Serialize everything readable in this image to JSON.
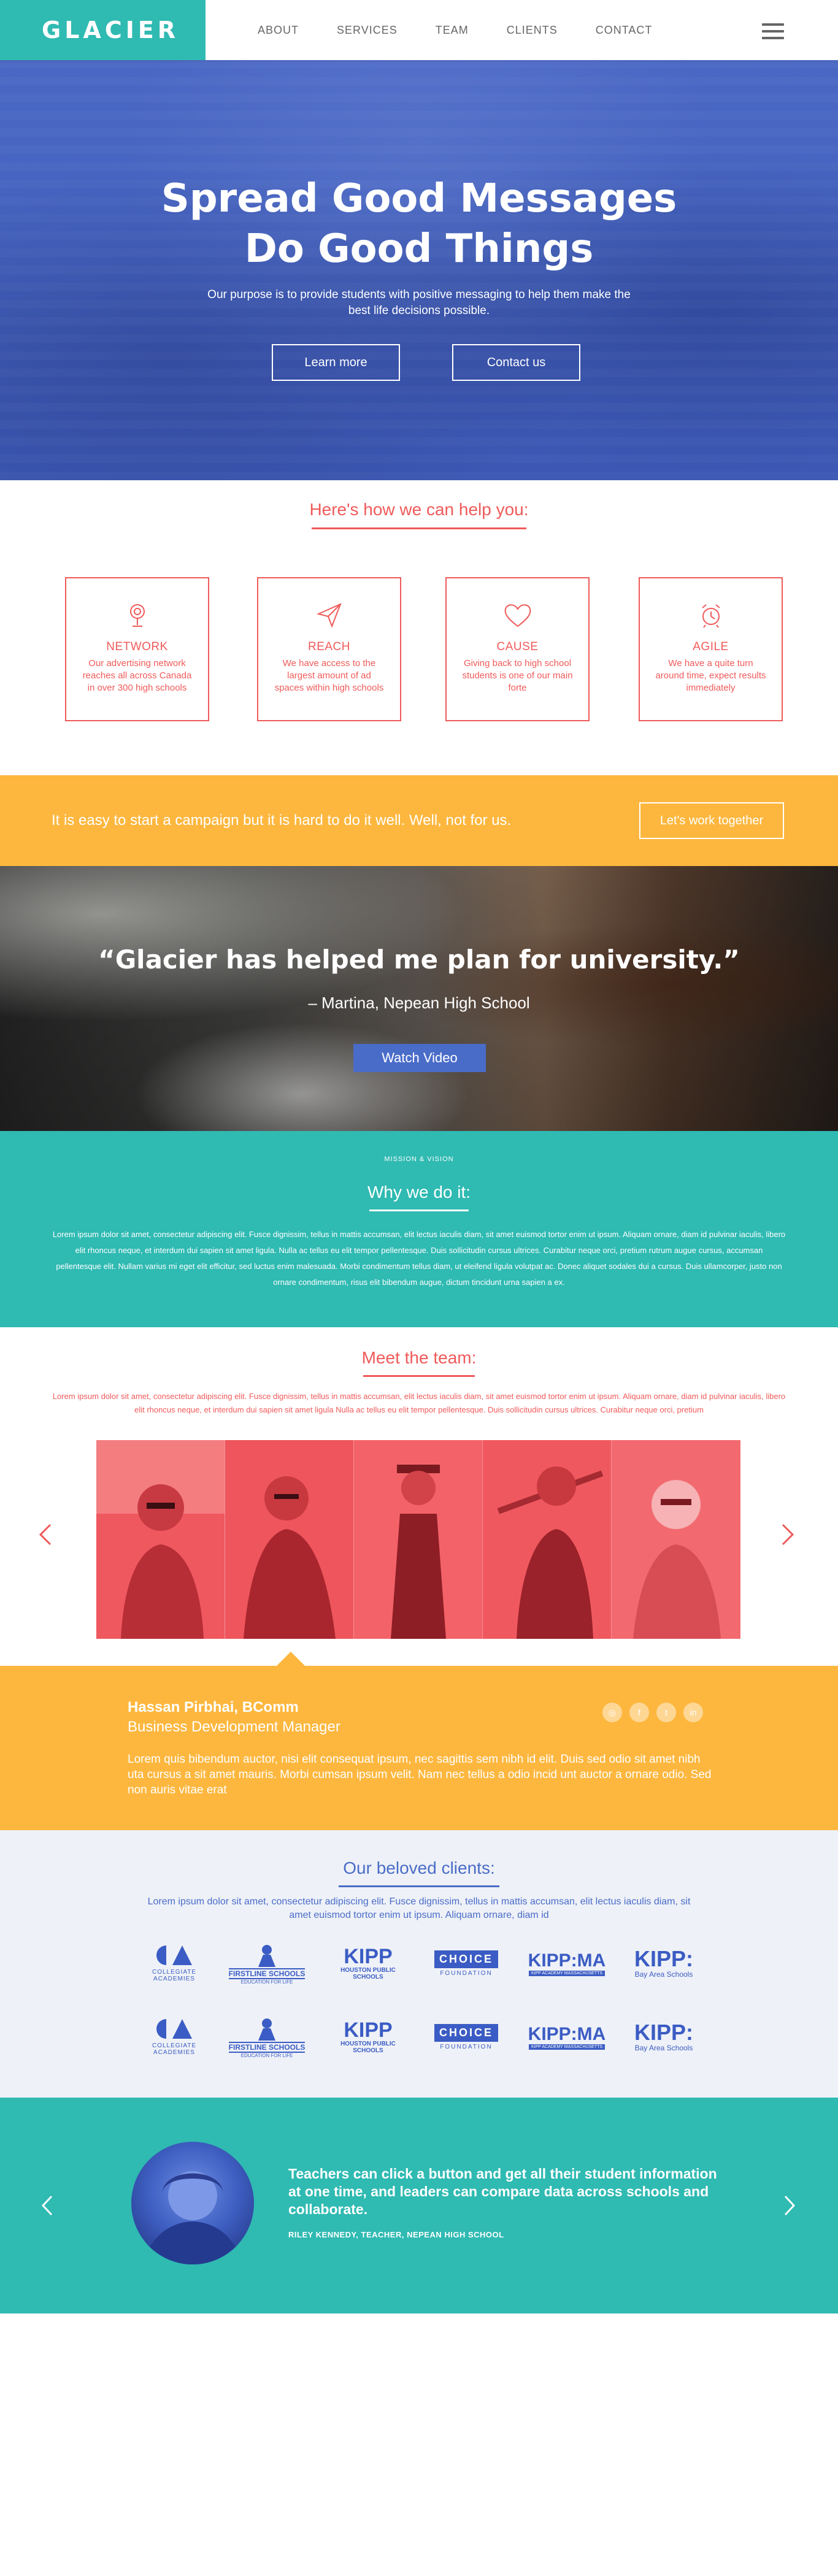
{
  "brand": {
    "logo": "GLACIER"
  },
  "nav": {
    "items": [
      {
        "label": "ABOUT"
      },
      {
        "label": "SERVICES"
      },
      {
        "label": "TEAM"
      },
      {
        "label": "CLIENTS"
      },
      {
        "label": "CONTACT"
      }
    ],
    "menu_icon": "hamburger-icon"
  },
  "hero": {
    "title_line1": "Spread Good Messages",
    "title_line2": "Do Good Things",
    "subtitle": "Our purpose is to provide students with positive messaging to help them make the best life decisions possible.",
    "btn_learn": "Learn more",
    "btn_contact": "Contact us"
  },
  "help": {
    "title": "Here's how we can help you:",
    "cards": [
      {
        "icon": "microphone-icon",
        "title": "NETWORK",
        "text": "Our advertising network reaches all across Canada in over 300 high schools"
      },
      {
        "icon": "paper-plane-icon",
        "title": "REACH",
        "text": "We have access to the largest amount of ad spaces within high schools"
      },
      {
        "icon": "heart-icon",
        "title": "CAUSE",
        "text": "Giving back to high school students is one of our main forte"
      },
      {
        "icon": "alarm-clock-icon",
        "title": "AGILE",
        "text": "We have a quite turn around time, expect results immediately"
      }
    ]
  },
  "campaign": {
    "text": "It is easy to start a campaign but it is hard to do it well. Well, not for us.",
    "button": "Let's work together"
  },
  "testimonial": {
    "quote": "“Glacier has helped me plan for university.”",
    "author": "– Martina, Nepean High School",
    "button": "Watch Video"
  },
  "why": {
    "kicker": "MISSION & VISION",
    "title": "Why we do it:",
    "text": "Lorem ipsum dolor sit amet, consectetur adipiscing elit. Fusce dignissim, tellus in mattis accumsan, elit lectus iaculis diam, sit amet euismod tortor enim ut ipsum. Aliquam ornare, diam id pulvinar iaculis, libero elit rhoncus neque, et interdum dui sapien sit amet ligula. Nulla ac tellus eu elit tempor pellentesque. Duis sollicitudin cursus ultrices. Curabitur neque orci, pretium rutrum augue cursus, accumsan pellentesque elit. Nullam varius mi eget elit efficitur, sed luctus enim malesuada. Morbi condimentum tellus diam, ut eleifend ligula volutpat ac. Donec aliquet sodales dui a cursus. Duis ullamcorper, justo non ornare condimentum, risus elit bibendum augue, dictum tincidunt urna sapien a ex."
  },
  "team": {
    "title": "Meet the team:",
    "text": "Lorem ipsum dolor sit amet, consectetur adipiscing elit. Fusce dignissim, tellus in mattis accumsan, elit lectus iaculis diam, sit amet euismod tortor enim ut ipsum. Aliquam ornare, diam id pulvinar iaculis, libero elit rhoncus neque, et interdum dui sapien sit amet ligula Nulla ac tellus eu elit tempor pellentesque. Duis sollicitudin cursus ultrices. Curabitur neque orci, pretium",
    "prev_icon": "chevron-left-icon",
    "next_icon": "chevron-right-icon"
  },
  "profile": {
    "name": "Hassan Pirbhai, BComm",
    "role": "Business Development Manager",
    "bio": "Lorem quis bibendum auctor, nisi elit consequat ipsum, nec sagittis sem nibh id elit. Duis sed odio sit amet nibh uta cursus a sit amet mauris. Morbi cumsan ipsum velit. Nam nec tellus a odio incid unt auctor a ornare odio. Sed non auris vitae erat",
    "social": [
      "instagram-icon",
      "facebook-icon",
      "twitter-icon",
      "linkedin-icon"
    ],
    "social_glyphs": [
      "◎",
      "f",
      "t",
      "in"
    ]
  },
  "clients": {
    "title": "Our beloved clients:",
    "text": "Lorem ipsum dolor sit amet, consectetur adipiscing elit. Fusce dignissim, tellus in mattis accumsan, elit lectus iaculis diam, sit amet euismod tortor enim ut ipsum. Aliquam ornare, diam id",
    "logos": [
      {
        "name": "COLLEGIATE",
        "sub": "ACADEMIES"
      },
      {
        "name": "FIRSTLINE SCHOOLS",
        "sub": "EDUCATION FOR LIFE"
      },
      {
        "name": "KIPP",
        "sub": "HOUSTON PUBLIC SCHOOLS"
      },
      {
        "name": "CHOICE",
        "sub": "FOUNDATION"
      },
      {
        "name": "KIPP:MA",
        "sub": "KIPP ACADEMY MASSACHUSETTS"
      },
      {
        "name": "KIPP:",
        "sub": "Bay Area Schools"
      }
    ]
  },
  "final": {
    "quote": "Teachers can click a button and get all their student information at one time, and leaders can compare data across schools and collaborate.",
    "author": "RILEY KENNEDY, TEACHER, NEPEAN HIGH SCHOOL"
  },
  "colors": {
    "teal": "#2fbab2",
    "blue": "#4a6cc9",
    "coral": "#f05a5a",
    "amber": "#fdb73e"
  }
}
